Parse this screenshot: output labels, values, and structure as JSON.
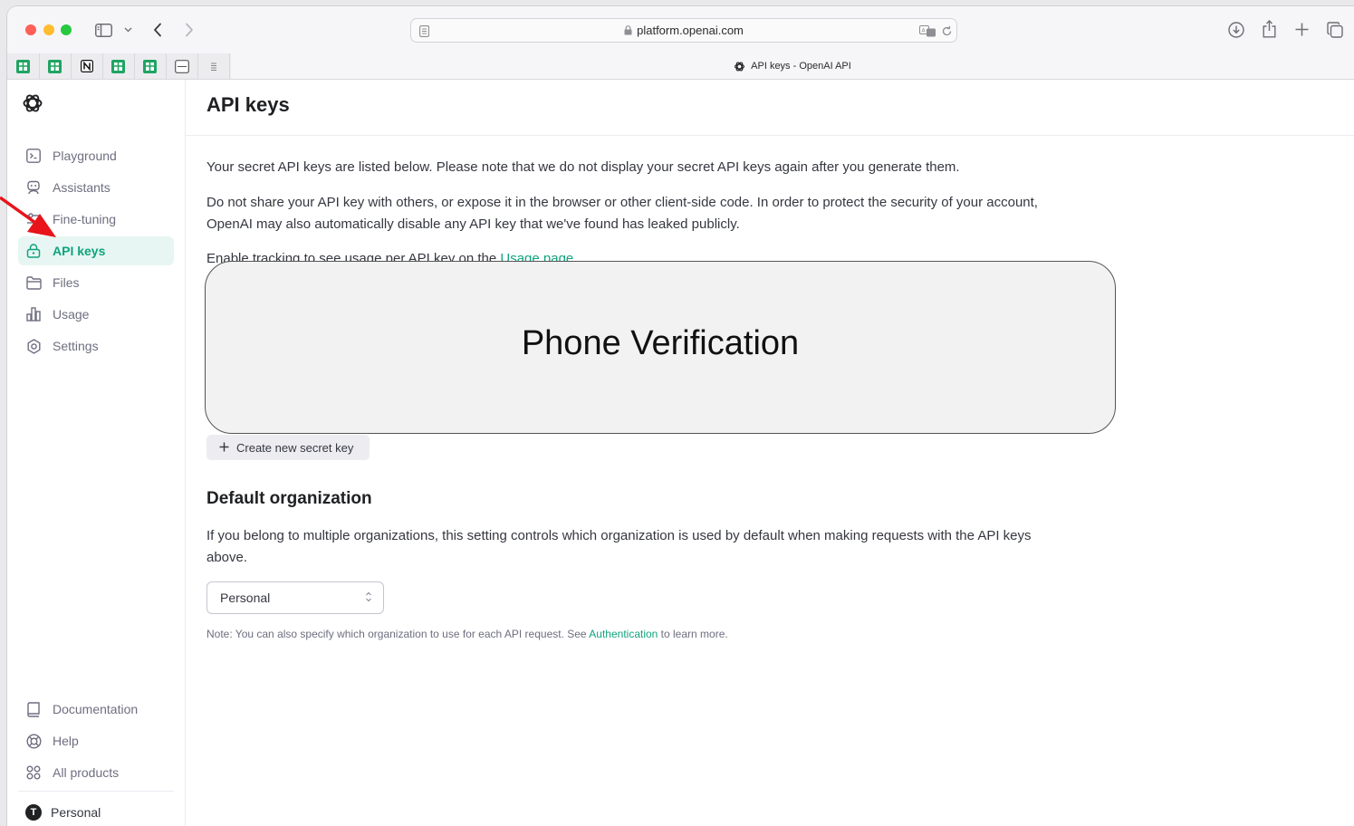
{
  "browser": {
    "url": "platform.openai.com",
    "tab_title": "API keys - OpenAI API"
  },
  "sidebar": {
    "items": [
      {
        "label": "Playground",
        "icon": "terminal-icon"
      },
      {
        "label": "Assistants",
        "icon": "robot-icon"
      },
      {
        "label": "Fine-tuning",
        "icon": "tune-icon"
      },
      {
        "label": "API keys",
        "icon": "lock-icon",
        "active": true
      },
      {
        "label": "Files",
        "icon": "folder-icon"
      },
      {
        "label": "Usage",
        "icon": "bar-chart-icon"
      },
      {
        "label": "Settings",
        "icon": "gear-icon"
      }
    ],
    "bottom_items": [
      {
        "label": "Documentation",
        "icon": "book-icon"
      },
      {
        "label": "Help",
        "icon": "lifebuoy-icon"
      },
      {
        "label": "All products",
        "icon": "grid-icon"
      }
    ],
    "account": {
      "label": "Personal",
      "avatar_letter": "T"
    }
  },
  "main": {
    "title": "API keys",
    "intro": "Your secret API keys are listed below. Please note that we do not display your secret API keys again after you generate them.",
    "warning": "Do not share your API key with others, or expose it in the browser or other client-side code. In order to protect the security of your account, OpenAI may also automatically disable any API key that we've found has leaked publicly.",
    "tracking_prefix": "Enable tracking to see usage per API key on the ",
    "tracking_link": "Usage page",
    "tracking_suffix": ".",
    "create_button": "Create new secret key",
    "default_org_title": "Default organization",
    "default_org_desc": "If you belong to multiple organizations, this setting controls which organization is used by default when making requests with the API keys above.",
    "org_select_value": "Personal",
    "note_prefix": "Note: You can also specify which organization to use for each API request. See ",
    "note_link": "Authentication",
    "note_suffix": " to learn more."
  },
  "overlay": {
    "text": "Phone Verification"
  },
  "colors": {
    "accent": "#10a37f",
    "active_bg": "#e7f6f2",
    "annotation_arrow": "#e8141a"
  }
}
